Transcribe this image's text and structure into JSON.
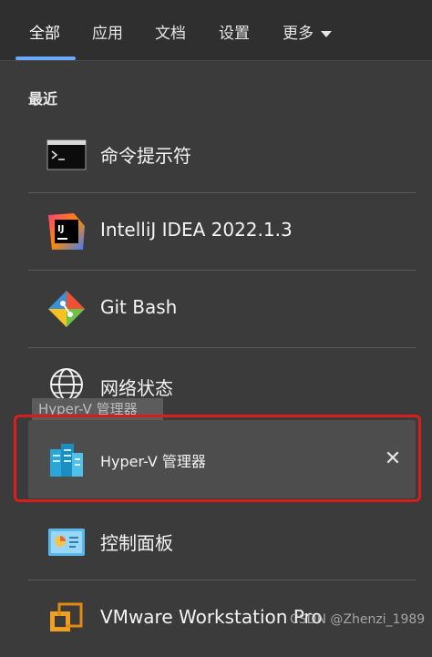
{
  "tabs": [
    {
      "label": "全部"
    },
    {
      "label": "应用"
    },
    {
      "label": "文档"
    },
    {
      "label": "设置"
    },
    {
      "label": "更多"
    }
  ],
  "section": {
    "title": "最近"
  },
  "items": [
    {
      "label": "命令提示符",
      "icon": "cmd-icon"
    },
    {
      "label": "IntelliJ IDEA 2022.1.3",
      "icon": "intellij-icon"
    },
    {
      "label": "Git Bash",
      "icon": "git-icon"
    },
    {
      "label": "网络状态",
      "icon": "globe-icon"
    },
    {
      "label": "Hyper-V 管理器",
      "icon": "hyperv-icon"
    },
    {
      "label": "控制面板",
      "icon": "control-panel-icon"
    },
    {
      "label": "VMware Workstation Pro",
      "icon": "vmware-icon"
    }
  ],
  "tooltip": {
    "text": "Hyper-V 管理器"
  },
  "watermark": {
    "text": "CSDN @Zhenzi_1989"
  },
  "colors": {
    "accent": "#6aa9ff",
    "highlight_frame": "#d91d1d"
  }
}
